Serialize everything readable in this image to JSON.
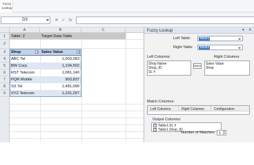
{
  "ribbon": {
    "button_line1": "Fuzzy",
    "button_line2": "Lookup"
  },
  "formula_bar": {
    "name_box": "D3",
    "cancel_glyph": "✕",
    "enter_glyph": "✓",
    "fx_label": "fx",
    "value": ""
  },
  "sheet": {
    "columns": [
      "A",
      "B",
      "C"
    ],
    "rows": [
      "1",
      "2",
      "3",
      "4",
      "5",
      "6",
      "7",
      "8",
      "9"
    ],
    "title_label": "Table: 2",
    "title_value": "Target Data Table",
    "table_headers": [
      "Shop",
      "Sales Value"
    ],
    "table_rows": [
      {
        "shop": "ABC Tel",
        "value": "1,003,283"
      },
      {
        "shop": "BW Corp",
        "value": "1,104,502"
      },
      {
        "shop": "RST Telecom",
        "value": "1,081,140"
      },
      {
        "shop": "PQR Mobile",
        "value": "903,837"
      },
      {
        "shop": "SS Tel",
        "value": "1,481,090"
      },
      {
        "shop": "XYZ Telecom",
        "value": "1,101,297"
      }
    ]
  },
  "pane": {
    "title": "Fuzzy Lookup",
    "dropdown_glyph": "▾",
    "close_glyph": "✕",
    "left_table_label": "Left Table:",
    "left_table_value": "Table1",
    "right_table_label": "Right Table:",
    "right_table_value": "Table2",
    "left_columns_label": "Left Columns:",
    "left_columns": [
      "Shop Name",
      "Shop_ID",
      "SL #"
    ],
    "match_button": "Match",
    "right_columns_label": "Right Columns:",
    "right_columns": [
      "Sales Value",
      "Shop"
    ],
    "match_columns_label": "Match Columns:",
    "match_headers": [
      "Left Columns",
      "Right Columns",
      "Configuration"
    ],
    "output_columns_label": "Output Columns:",
    "output_columns": [
      "Table1.SL #",
      "Table1.Shop_ID"
    ],
    "num_matches_label": "Number of Matches:",
    "num_matches_value": "1"
  }
}
